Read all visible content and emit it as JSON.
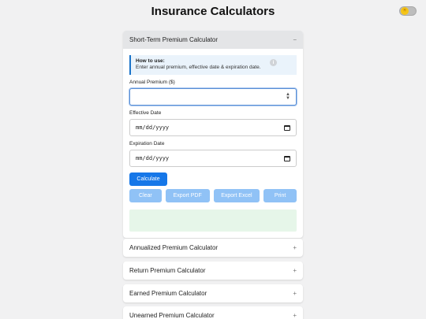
{
  "page": {
    "title": "Insurance Calculators"
  },
  "theme_toggle": {
    "icon": "sun-icon"
  },
  "short_term": {
    "title": "Short-Term Premium Calculator",
    "toggle": "−",
    "howto": {
      "title": "How to use:",
      "text": "Enter annual premium, effective date & expiration date.",
      "icon": "i"
    },
    "annual_premium": {
      "label": "Annual Premium ($)",
      "value": ""
    },
    "effective_date": {
      "label": "Effective Date",
      "value": "mm/dd/yyyy"
    },
    "expiration_date": {
      "label": "Expiration Date",
      "value": "mm/dd/yyyy"
    },
    "buttons": {
      "calculate": "Calculate",
      "clear": "Clear",
      "export_pdf": "Export PDF",
      "export_excel": "Export Excel",
      "print": "Print"
    },
    "result": ""
  },
  "collapsed_calculators": [
    {
      "title": "Annualized Premium Calculator",
      "toggle": "+"
    },
    {
      "title": "Return Premium Calculator",
      "toggle": "+"
    },
    {
      "title": "Earned Premium Calculator",
      "toggle": "+"
    },
    {
      "title": "Unearned Premium Calculator",
      "toggle": "+"
    }
  ],
  "colors": {
    "primary": "#1677e8",
    "primary_light": "#90c2f6",
    "info_bg": "#eaf3fb",
    "result_bg": "#e6f6e9"
  }
}
